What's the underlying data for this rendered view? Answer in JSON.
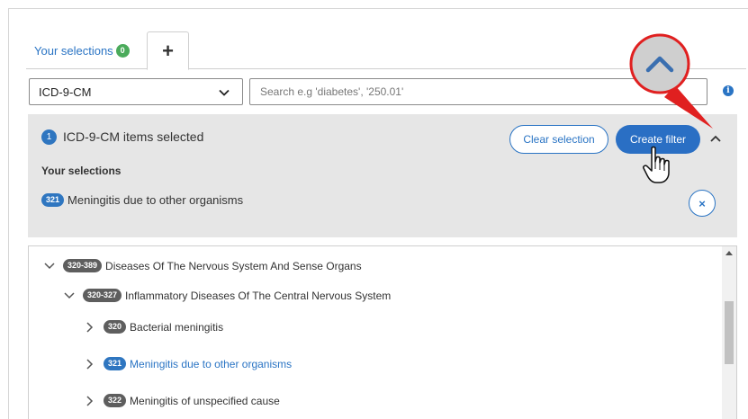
{
  "tabs": {
    "selections_label": "Your selections",
    "selections_count": "0",
    "add_label": "+"
  },
  "filter": {
    "code_system": "ICD-9-CM",
    "search_placeholder": "Search e.g 'diabetes', '250.01'",
    "info_icon": "i"
  },
  "summary": {
    "count": "1",
    "title": "ICD-9-CM items selected",
    "clear_label": "Clear selection",
    "create_label": "Create filter",
    "subheading": "Your selections",
    "selected": [
      {
        "code": "321",
        "label": "Meningitis due to other organisms"
      }
    ],
    "remove_label": "×"
  },
  "tree": {
    "rows": [
      {
        "code": "320-389",
        "label": "Diseases Of The Nervous System And Sense Organs",
        "expanded": true,
        "selected": false
      },
      {
        "code": "320-327",
        "label": "Inflammatory Diseases Of The Central Nervous System",
        "expanded": true,
        "selected": false
      },
      {
        "code": "320",
        "label": "Bacterial meningitis",
        "expanded": false,
        "selected": false
      },
      {
        "code": "321",
        "label": "Meningitis due to other organisms",
        "expanded": false,
        "selected": true
      },
      {
        "code": "322",
        "label": "Meningitis of unspecified cause",
        "expanded": false,
        "selected": false
      }
    ]
  },
  "colors": {
    "accent": "#2a74c4",
    "success": "#4bab5b",
    "annotation": "#e02020",
    "summary_bg": "#e6e6e6"
  },
  "icons": [
    "chevron-down-icon",
    "chevron-up-icon",
    "chevron-right-icon",
    "info-icon",
    "close-icon",
    "hand-pointer-icon",
    "plus-icon"
  ]
}
